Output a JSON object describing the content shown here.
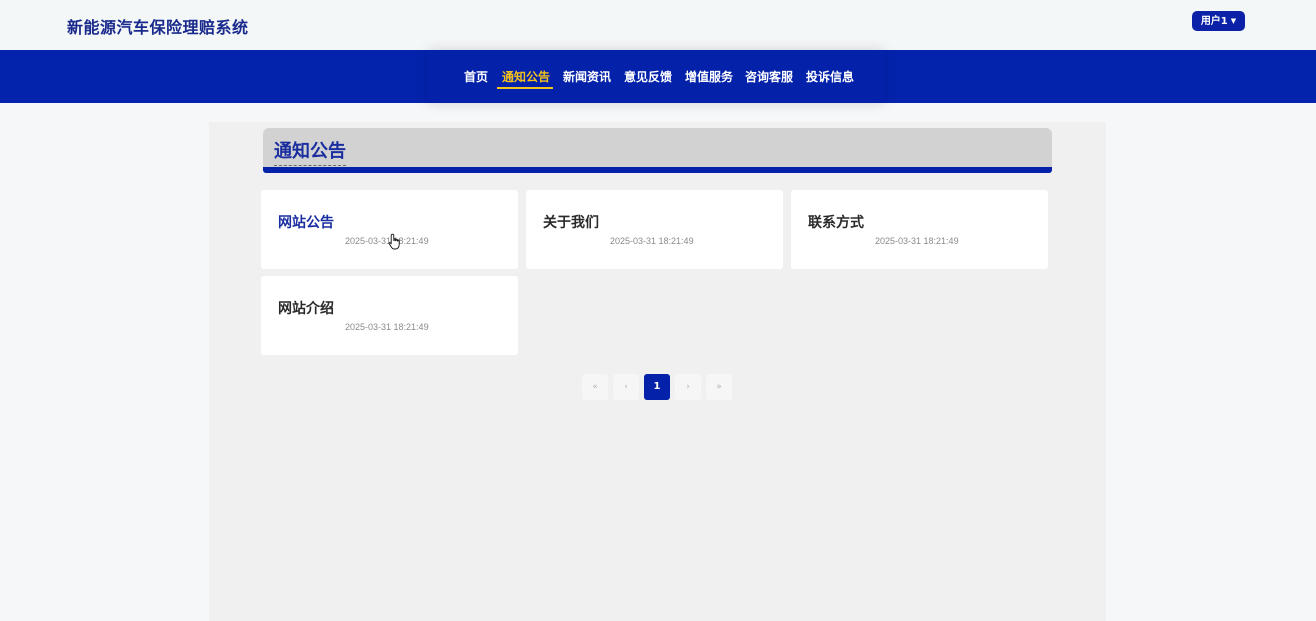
{
  "header": {
    "site_title": "新能源汽车保险理赔系统",
    "user_label": "用户1"
  },
  "nav": {
    "items": [
      {
        "label": "首页"
      },
      {
        "label": "通知公告"
      },
      {
        "label": "新闻资讯"
      },
      {
        "label": "意见反馈"
      },
      {
        "label": "增值服务"
      },
      {
        "label": "咨询客服"
      },
      {
        "label": "投诉信息"
      }
    ],
    "active_index": 1
  },
  "section": {
    "title": "通知公告"
  },
  "notices": [
    {
      "title": "网站公告",
      "date": "2025-03-31 18:21:49"
    },
    {
      "title": "关于我们",
      "date": "2025-03-31 18:21:49"
    },
    {
      "title": "联系方式",
      "date": "2025-03-31 18:21:49"
    },
    {
      "title": "网站介绍",
      "date": "2025-03-31 18:21:49"
    }
  ],
  "pagination": {
    "first": "«",
    "prev": "‹",
    "current": "1",
    "next": "›",
    "last": "»"
  },
  "colors": {
    "brand_blue": "#0421aa",
    "active_yellow": "#f4c21c"
  }
}
